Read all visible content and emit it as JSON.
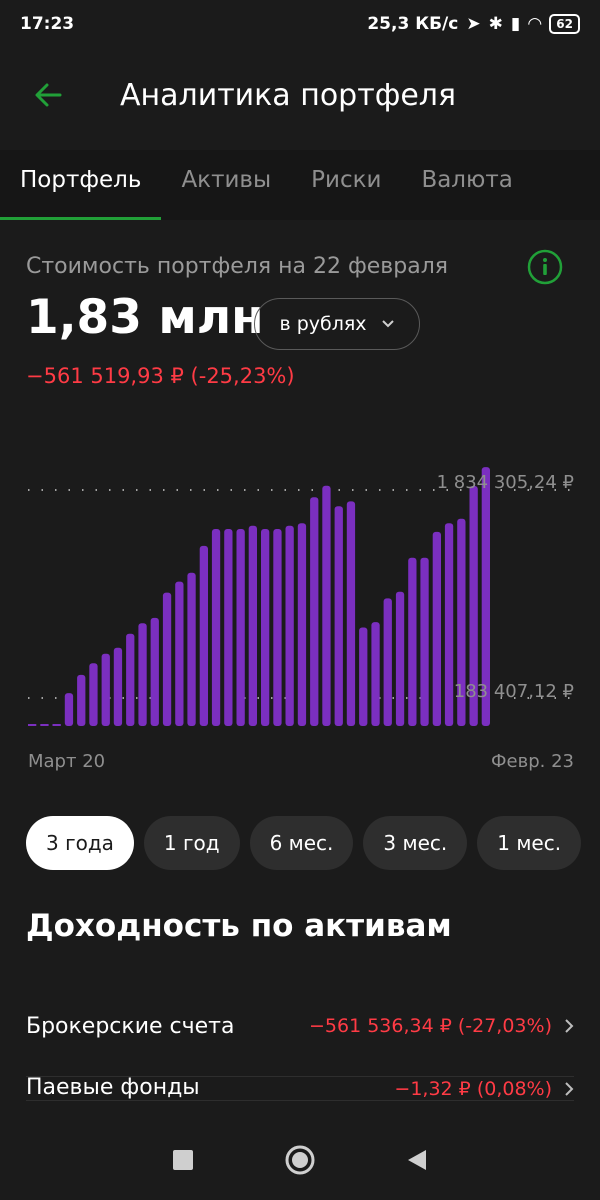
{
  "status_bar": {
    "time": "17:23",
    "speed": "25,3 КБ/с",
    "battery": "62"
  },
  "header": {
    "title": "Аналитика портфеля"
  },
  "tabs": [
    {
      "label": "Портфель",
      "active": true
    },
    {
      "label": "Активы",
      "active": false
    },
    {
      "label": "Риски",
      "active": false
    },
    {
      "label": "Валюта",
      "active": false
    }
  ],
  "portfolio": {
    "caption": "Стоимость портфеля на 22 февраля",
    "value": "1,83 млн",
    "currency_select": "в рублях",
    "change": "−561 519,93 ₽ (-25,23%)"
  },
  "chart_data": {
    "type": "bar",
    "y_max_label": "1 834 305,24 ₽",
    "y_min_label": "183 407,12 ₽",
    "x_start_label": "Март 20",
    "x_end_label": "Февр. 23",
    "ylim": [
      183407.12,
      1834305.24
    ],
    "values": [
      0,
      0,
      0,
      222000,
      367000,
      460000,
      534000,
      583000,
      694000,
      777000,
      819000,
      1020000,
      1107000,
      1177000,
      1391000,
      1525000,
      1525000,
      1525000,
      1550000,
      1525000,
      1525000,
      1550000,
      1571000,
      1776000,
      1868000,
      1706000,
      1744000,
      743000,
      786000,
      974000,
      1026000,
      1296000,
      1296000,
      1502000,
      1571000,
      1606000,
      1866000,
      2016000
    ],
    "colors": {
      "bar": "#7b2fc0",
      "grid": "#cfcfcf"
    }
  },
  "periods": [
    {
      "label": "3 года",
      "active": true
    },
    {
      "label": "1 год",
      "active": false
    },
    {
      "label": "6 мес.",
      "active": false
    },
    {
      "label": "3 мес.",
      "active": false
    },
    {
      "label": "1 мес.",
      "active": false
    }
  ],
  "yield": {
    "title": "Доходность по активам",
    "rows": [
      {
        "name": "Брокерские счета",
        "value": "−561 536,34 ₽ (-27,03%)"
      },
      {
        "name": "Паевые фонды",
        "value": "−1,32 ₽ (0,08%)"
      }
    ]
  },
  "icons": {
    "back": "arrow-left-icon",
    "info": "info-icon",
    "chevron": "chevron-right-icon"
  },
  "colors": {
    "accent": "#21a038",
    "negative": "#ff3b45",
    "background": "#1b1b1b"
  }
}
